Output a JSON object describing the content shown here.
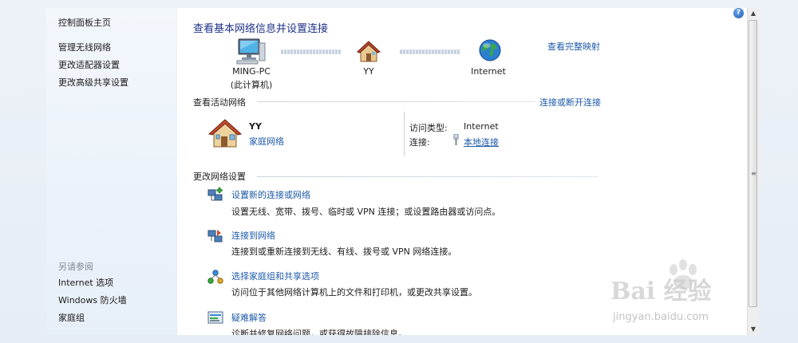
{
  "sidebar": {
    "control_panel_home": "控制面板主页",
    "manage_wireless": "管理无线网络",
    "change_adapter": "更改适配器设置",
    "change_sharing": "更改高级共享设置",
    "see_also": "另请参阅",
    "internet_options": "Internet 选项",
    "windows_firewall": "Windows 防火墙",
    "homegroup": "家庭组"
  },
  "header": {
    "title": "查看基本网络信息并设置连接",
    "full_map_link": "查看完整映射"
  },
  "network_map": {
    "computer_name": "MING-PC",
    "computer_sub": "(此计算机)",
    "network_name": "YY",
    "internet_label": "Internet"
  },
  "active_networks": {
    "section_label": "查看活动网络",
    "connect_link": "连接或断开连接",
    "network_name": "YY",
    "network_type": "家庭网络",
    "access_type_label": "访问类型:",
    "access_type_value": "Internet",
    "connection_label": "连接:",
    "connection_value": "本地连接"
  },
  "change_settings": {
    "section_label": "更改网络设置",
    "tasks": [
      {
        "title": "设置新的连接或网络",
        "desc": "设置无线、宽带、拨号、临时或 VPN 连接；或设置路由器或访问点。",
        "icon": "network-setup-icon"
      },
      {
        "title": "连接到网络",
        "desc": "连接到或重新连接到无线、有线、拨号或 VPN 网络连接。",
        "icon": "connect-network-icon"
      },
      {
        "title": "选择家庭组和共享选项",
        "desc": "访问位于其他网络计算机上的文件和打印机，或更改共享设置。",
        "icon": "homegroup-icon"
      },
      {
        "title": "疑难解答",
        "desc": "诊断并修复网络问题，或获得故障排除信息。",
        "icon": "troubleshoot-icon"
      }
    ]
  },
  "watermark": {
    "brand": "Bai 经验",
    "url": "jingyan.baidu.com"
  },
  "colors": {
    "link": "#1e5aa8",
    "title": "#1e3287",
    "sidebar_bg": "#eef4fa"
  }
}
